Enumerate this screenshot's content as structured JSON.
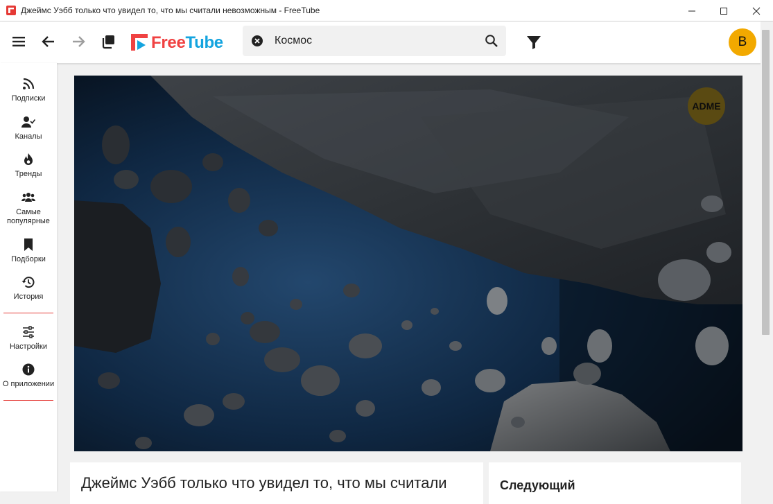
{
  "window": {
    "title": "Джеймс Уэбб только что увидел то, что мы считали невозможным - FreeTube"
  },
  "toolbar": {
    "menu_icon": "hamburger-menu-icon",
    "back_icon": "arrow-left-icon",
    "forward_icon": "arrow-right-icon",
    "new_window_icon": "copy-window-icon",
    "logo_free": "Free",
    "logo_tube": "Tube"
  },
  "search": {
    "value": "Космос",
    "clear_icon": "close-circle-icon",
    "search_icon": "search-icon"
  },
  "filter_icon": "filter-icon",
  "profile": {
    "initial": "B"
  },
  "sidebar": {
    "items": [
      {
        "label": "Подписки",
        "icon": "rss-icon"
      },
      {
        "label": "Каналы",
        "icon": "user-check-icon"
      },
      {
        "label": "Тренды",
        "icon": "fire-icon"
      },
      {
        "label": "Самые популярные",
        "icon": "users-icon"
      },
      {
        "label": "Подборки",
        "icon": "bookmark-icon"
      },
      {
        "label": "История",
        "icon": "history-icon"
      },
      {
        "label": "Настройки",
        "icon": "sliders-icon"
      },
      {
        "label": "О приложении",
        "icon": "info-circle-icon"
      }
    ]
  },
  "video": {
    "channel_watermark": "ADME",
    "title": "Джеймс Уэбб только что увидел то, что мы считали"
  },
  "next": {
    "heading": "Следующий"
  },
  "colors": {
    "accent_red": "#f04242",
    "accent_blue": "#14a4df",
    "avatar_bg": "#f2a900",
    "sidebar_divider": "#e53935"
  }
}
